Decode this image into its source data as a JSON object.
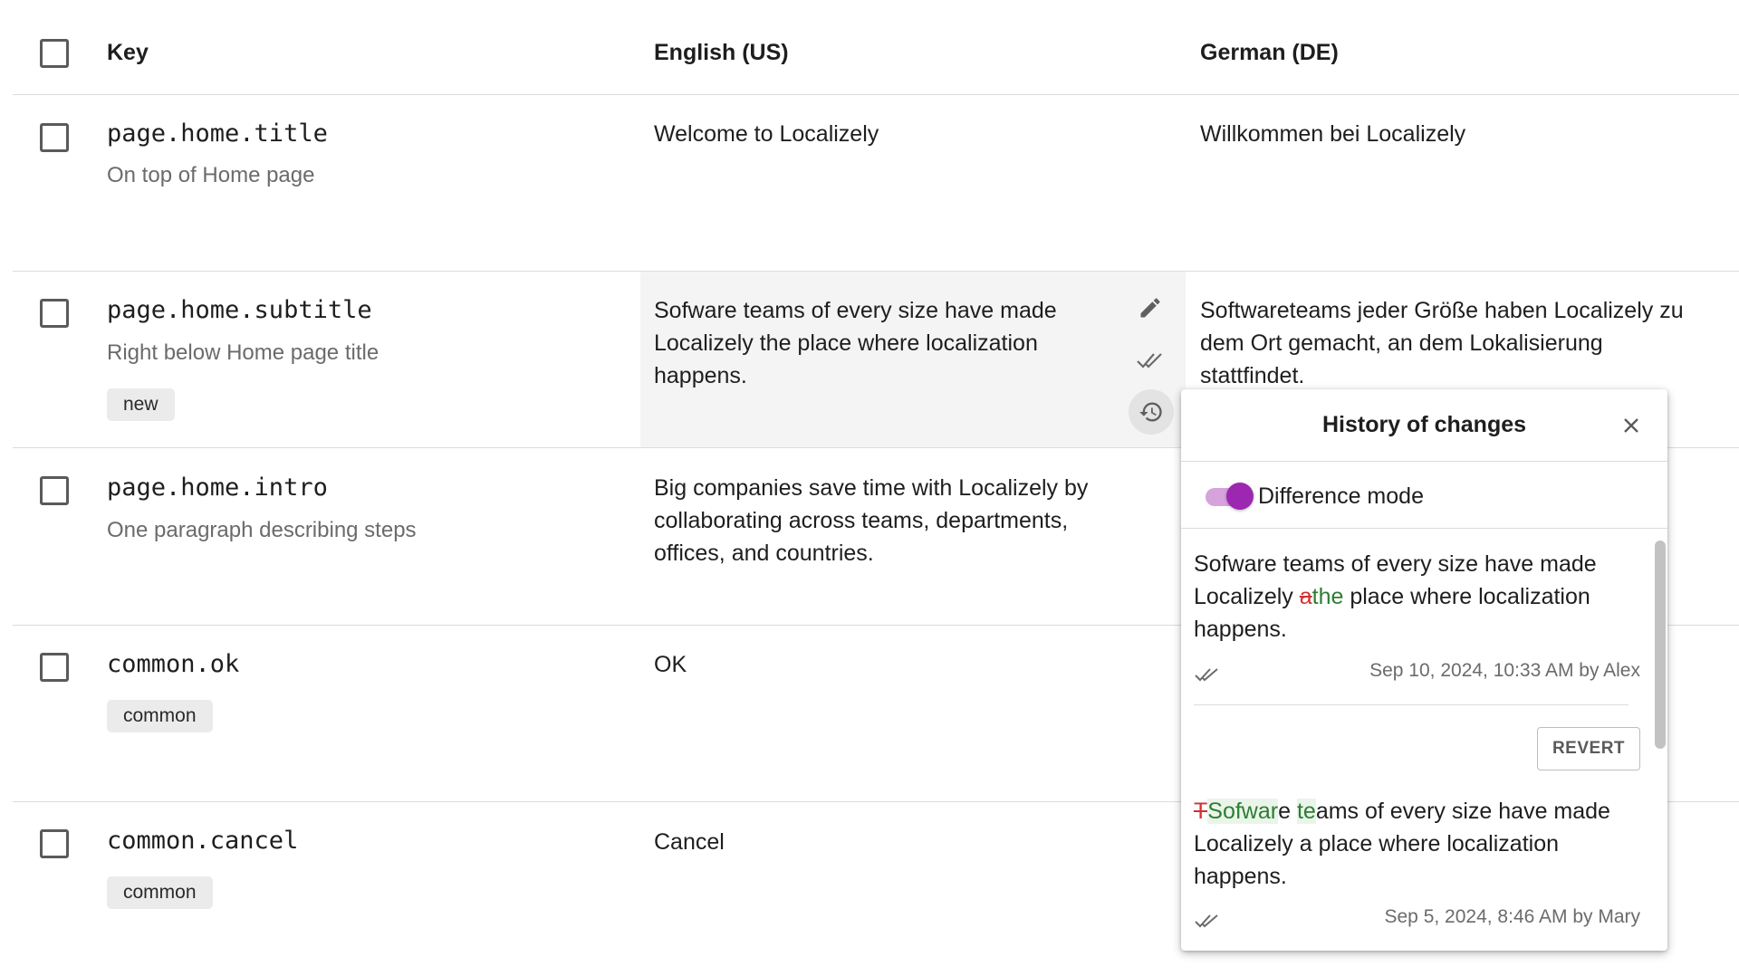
{
  "columns": {
    "key": "Key",
    "english": "English (US)",
    "german": "German (DE)"
  },
  "rows": [
    {
      "key": "page.home.title",
      "description": "On top of Home page",
      "tag": "",
      "en": "Welcome to Localizely",
      "de": "Willkommen bei Localizely"
    },
    {
      "key": "page.home.subtitle",
      "description": "Right below Home page title",
      "tag": "new",
      "en": "Sofware teams of every size have made Localizely the place where localization happens.",
      "de": "Softwareteams jeder Größe haben Localizely zu dem Ort gemacht, an dem Lokalisierung stattfindet."
    },
    {
      "key": "page.home.intro",
      "description": "One paragraph describing steps",
      "tag": "",
      "en": "Big companies save time with Localizely by collaborating across teams, departments, offices, and countries.",
      "de": ""
    },
    {
      "key": "common.ok",
      "description": "",
      "tag": "common",
      "en": "OK",
      "de": ""
    },
    {
      "key": "common.cancel",
      "description": "",
      "tag": "common",
      "en": "Cancel",
      "de": ""
    }
  ],
  "cell_actions": {
    "edit_icon": "pencil-icon",
    "verify_icon": "double-check-icon",
    "history_icon": "history-icon"
  },
  "history_popup": {
    "title": "History of changes",
    "close_icon": "close-icon",
    "difference_mode_label": "Difference mode",
    "difference_mode_on": true,
    "accent_color": "#9c27b0",
    "entries": [
      {
        "line1": "Sofware teams of every size have made",
        "line2_pre": "Localizely ",
        "line2_del": "a",
        "line2_ins": "the",
        "line2_post": " place where localization",
        "line3": "happens.",
        "meta": "Sep 10, 2024, 10:33 AM by Alex",
        "revert_label": "REVERT"
      },
      {
        "line1_del": "T",
        "line1_ins1": "Sofwar",
        "line1_mid": "e ",
        "line1_ins2": "te",
        "line1_post": "ams of every size have made",
        "line2": "Localizely a place where localization",
        "line3": "happens.",
        "meta": "Sep 5, 2024, 8:46 AM by Mary"
      }
    ]
  }
}
